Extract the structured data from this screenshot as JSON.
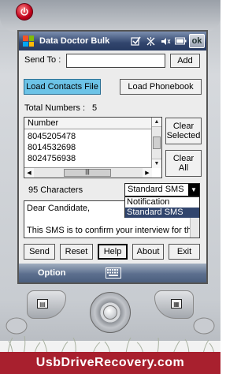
{
  "window": {
    "title": "Data Doctor Bulk",
    "ok_label": "ok"
  },
  "form": {
    "send_to_label": "Send To :",
    "send_to_value": "",
    "add_label": "Add",
    "load_contacts_label": "Load Contacts File",
    "load_phonebook_label": "Load Phonebook",
    "total_numbers_label": "Total Numbers :",
    "total_numbers_value": "5",
    "list_header": "Number",
    "numbers": [
      "8045205478",
      "8014532698",
      "8024756938"
    ],
    "clear_selected_line1": "Clear",
    "clear_selected_line2": "Selected",
    "clear_all_line1": "Clear",
    "clear_all_line2": "All",
    "characters_label": "95 Characters",
    "sms_type_selected": "Standard SMS",
    "sms_type_options": [
      "Notification",
      "Standard SMS"
    ],
    "message_lines": [
      "Dear Candidate,",
      "",
      "This SMS is to confirm your interview for the"
    ]
  },
  "buttons": {
    "send": "Send",
    "reset": "Reset",
    "help": "Help",
    "about": "About",
    "exit": "Exit"
  },
  "menubar": {
    "option_label": "Option"
  },
  "banner": {
    "text": "UsbDriveRecovery.com"
  },
  "colors": {
    "accent": "#6cc3e7",
    "titlebar": "#31456d",
    "banner": "#a8202e"
  },
  "icons": [
    "power-icon",
    "windows-logo-icon",
    "checkmark-icon",
    "connectivity-icon",
    "speaker-icon",
    "battery-icon",
    "keyboard-icon"
  ]
}
